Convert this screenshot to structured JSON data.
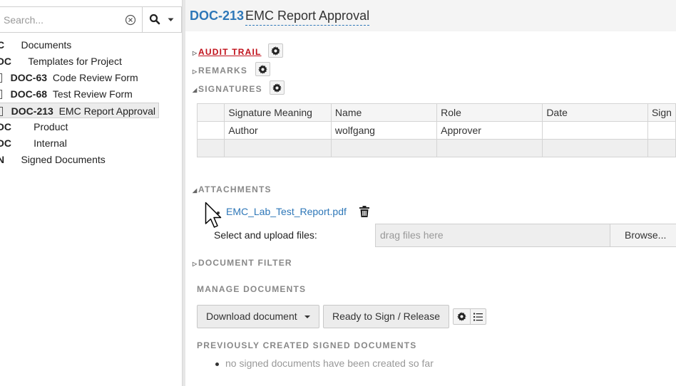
{
  "search": {
    "placeholder": "Search..."
  },
  "tree": {
    "items": [
      {
        "code": "C",
        "label": "Documents"
      },
      {
        "code": "OC",
        "label": "Templates for Project"
      },
      {
        "code": "DOC-63",
        "label": "Code Review Form"
      },
      {
        "code": "DOC-68",
        "label": "Test Review Form"
      },
      {
        "code": "DOC-213",
        "label": "EMC Report Approval"
      },
      {
        "code": "OC",
        "label": "Product"
      },
      {
        "code": "OC",
        "label": "Internal"
      },
      {
        "code": "N",
        "label": "Signed Documents"
      }
    ]
  },
  "header": {
    "doc_id": "DOC-213",
    "title": "EMC Report Approval"
  },
  "sections": {
    "audit_trail": "AUDIT TRAIL",
    "remarks": "REMARKS",
    "signatures": "SIGNATURES",
    "attachments": "ATTACHMENTS",
    "document_filter": "DOCUMENT FILTER",
    "manage_documents": "MANAGE DOCUMENTS",
    "previously_signed": "PREVIOUSLY CREATED SIGNED DOCUMENTS"
  },
  "signatures_table": {
    "columns": [
      "",
      "Signature Meaning",
      "Name",
      "Role",
      "Date",
      "Sign"
    ],
    "rows": [
      [
        "",
        "Author",
        "wolfgang",
        "Approver",
        "",
        ""
      ]
    ]
  },
  "attachments": {
    "file_name": "EMC_Lab_Test_Report.pdf",
    "upload_label": "Select and upload files:",
    "drop_placeholder": "drag files here",
    "browse_label": "Browse..."
  },
  "manage": {
    "download_label": "Download document",
    "ready_label": "Ready to Sign / Release"
  },
  "previously_signed": {
    "empty_text": "no signed documents have been created so far"
  },
  "colors": {
    "link": "#2e77b8",
    "audit_link": "#c0101a",
    "section_grey": "#888888"
  }
}
